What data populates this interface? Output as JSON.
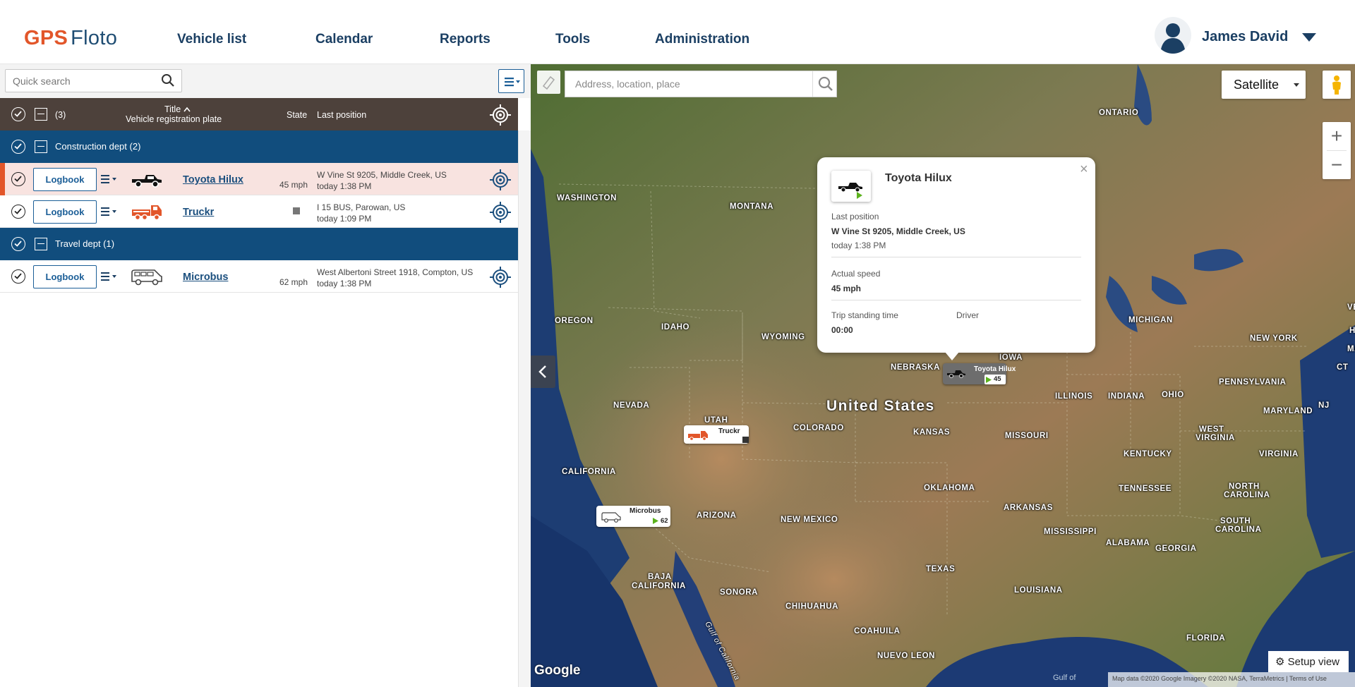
{
  "header": {
    "logo_gps": "GPS",
    "logo_floto": "Floto",
    "nav": [
      "Vehicle list",
      "Calendar",
      "Reports",
      "Tools",
      "Administration"
    ],
    "user_name": "James David"
  },
  "sidebar": {
    "quick_search_placeholder": "Quick search",
    "table_head": {
      "count": "(3)",
      "title": "Title",
      "subtitle": "Vehicle registration plate",
      "state": "State",
      "last_position": "Last position"
    },
    "groups": [
      {
        "label": "Construction dept (2)"
      },
      {
        "label": "Travel dept (1)"
      }
    ],
    "vehicles": [
      {
        "logbook": "Logbook",
        "title": "Toyota Hilux",
        "speed": "45 mph",
        "address": "W Vine St 9205, Middle Creek, US",
        "time": "today 1:38 PM",
        "selected": true,
        "icon": "pickup-truck-icon"
      },
      {
        "logbook": "Logbook",
        "title": "Truckr",
        "speed": "",
        "address": "I 15 BUS, Parowan, US",
        "time": "today 1:09 PM",
        "selected": false,
        "icon": "truck-icon"
      },
      {
        "logbook": "Logbook",
        "title": "Microbus",
        "speed": "62 mph",
        "address": "West Albertoni Street 1918, Compton, US",
        "time": "today 1:38 PM",
        "selected": false,
        "icon": "van-icon"
      }
    ]
  },
  "map": {
    "address_placeholder": "Address, location, place",
    "map_type": "Satellite",
    "zoom_in": "+",
    "zoom_out": "−",
    "popup": {
      "title": "Toyota Hilux",
      "last_position_label": "Last position",
      "last_position_value": "W Vine St 9205, Middle Creek, US",
      "last_position_time": "today 1:38 PM",
      "speed_label": "Actual speed",
      "speed_value": "45 mph",
      "standing_label": "Trip standing time",
      "standing_value": "00:00",
      "driver_label": "Driver"
    },
    "markers": {
      "hilux": {
        "title": "Toyota Hilux",
        "speed": "45"
      },
      "truckr": {
        "title": "Truckr"
      },
      "microbus": {
        "title": "Microbus",
        "speed": "62"
      }
    },
    "labels": {
      "ontario": "ONTARIO",
      "washington": "WASHINGTON",
      "montana": "MONTANA",
      "oregon": "OREGON",
      "idaho": "IDAHO",
      "wyoming": "WYOMING",
      "nebraska": "NEBRASKA",
      "iowa": "IOWA",
      "nevada": "NEVADA",
      "utah": "UTAH",
      "colorado": "COLORADO",
      "kansas": "KANSAS",
      "illinois": "ILLINOIS",
      "indiana": "INDIANA",
      "ohio": "OHIO",
      "michigan": "MICHIGAN",
      "new_york": "NEW YORK",
      "pennsylvania": "PENNSYLVANIA",
      "vermont": "VERMO",
      "mass": "MASSA",
      "nh": "HAM",
      "ct": "CT",
      "nj": "NJ",
      "maryland": "MARYLAND",
      "west_virginia_1": "WEST",
      "west_virginia_2": "VIRGINIA",
      "virginia": "VIRGINIA",
      "kentucky": "KENTUCKY",
      "missouri": "MISSOURI",
      "california": "CALIFORNIA",
      "arizona": "ARIZONA",
      "new_mexico": "NEW MEXICO",
      "oklahoma": "OKLAHOMA",
      "arkansas": "ARKANSAS",
      "tennessee": "TENNESSEE",
      "north_carolina_1": "NORTH",
      "north_carolina_2": "CAROLINA",
      "south_carolina_1": "SOUTH",
      "south_carolina_2": "CAROLINA",
      "mississippi": "MISSISSIPPI",
      "alabama": "ALABAMA",
      "georgia": "GEORGIA",
      "texas": "TEXAS",
      "louisiana": "LOUISIANA",
      "florida": "FLORIDA",
      "baja_1": "BAJA",
      "baja_2": "CALIFORNIA",
      "sonora": "SONORA",
      "chihuahua": "CHIHUAHUA",
      "coahuila": "COAHUILA",
      "nuevo_leon": "NUEVO LEON",
      "united_states": "United States",
      "gulf_of_california": "Gulf of California",
      "gulf_of": "Gulf of"
    },
    "setup_view": "Setup view",
    "google": "Google",
    "map_data": "Map data ©2020 Google Imagery ©2020 NASA, TerraMetrics | Terms of Use"
  },
  "colors": {
    "brand_orange": "#e2562a",
    "brand_blue": "#1b3f63",
    "group_row": "#114d7d",
    "table_head": "#4d413b"
  }
}
